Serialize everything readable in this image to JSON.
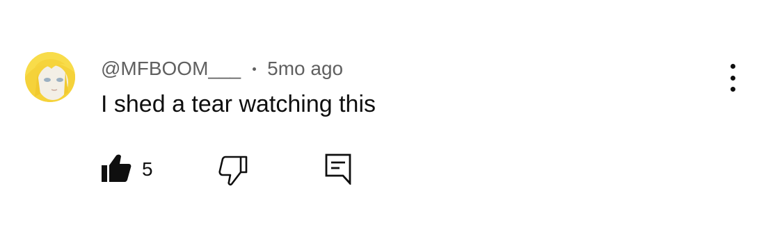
{
  "comment": {
    "author": "@MFBOOM___",
    "time": "5mo ago",
    "text": "I shed a tear watching this",
    "like_count": "5"
  },
  "icons": {
    "avatar": "anime-avatar",
    "more": "more-vert-icon",
    "like": "thumbs-up-filled-icon",
    "dislike": "thumbs-down-outline-icon",
    "reply": "reply-comment-icon"
  },
  "colors": {
    "primary_text": "#0f0f0f",
    "secondary_text": "#606060",
    "avatar_bg": "#f5d23a"
  }
}
